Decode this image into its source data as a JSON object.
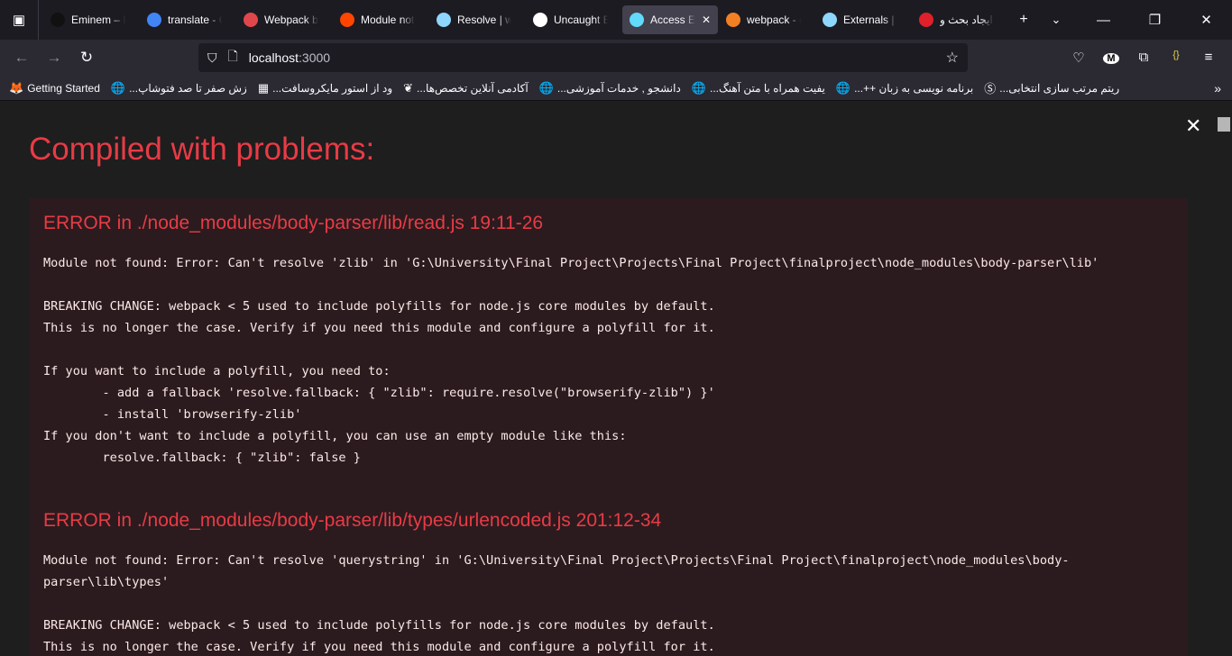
{
  "tabs": [
    {
      "label": "Eminem – B",
      "icon": "eminem-icon",
      "color": "#111111"
    },
    {
      "label": "translate - G",
      "icon": "google-icon",
      "color": "#4285f4"
    },
    {
      "label": "Webpack bu",
      "icon": "webpack-cube-icon",
      "color": "#e0474c"
    },
    {
      "label": "Module not",
      "icon": "reddit-icon",
      "color": "#ff4500"
    },
    {
      "label": "Resolve | we",
      "icon": "webpack-icon",
      "color": "#8ed6fb"
    },
    {
      "label": "Uncaught Er",
      "icon": "github-icon",
      "color": "#ffffff"
    },
    {
      "label": "Access E-",
      "icon": "react-icon",
      "color": "#61dafb",
      "active": true
    },
    {
      "label": "webpack - (",
      "icon": "stackoverflow-icon",
      "color": "#f48024"
    },
    {
      "label": "Externals | w",
      "icon": "webpack-icon",
      "color": "#8ed6fb"
    },
    {
      "label": "ایجاد بحث و",
      "icon": "magnet-icon",
      "color": "#e0202a"
    }
  ],
  "url": {
    "host": "localhost",
    "port": ":3000"
  },
  "bookmarks": [
    {
      "label": "Getting Started",
      "icon": "firefox-icon"
    },
    {
      "label": "...زش صفر تا صد فتوشاپ",
      "icon": "globe-icon"
    },
    {
      "label": "...ود از استور مایکروسافت",
      "icon": "microsoft-store-icon"
    },
    {
      "label": "...آکادمی آنلاین تخصص‌ها",
      "icon": "academy-icon"
    },
    {
      "label": "...دانشجو , خدمات آموزشی",
      "icon": "globe-icon"
    },
    {
      "label": "...یفیت همراه با متن آهنگ",
      "icon": "globe-icon"
    },
    {
      "label": "...++ برنامه نویسی به زبان",
      "icon": "globe-icon"
    },
    {
      "label": "...ریتم مرتب سازی انتخابی",
      "icon": "s-icon"
    }
  ],
  "overlay": {
    "title": "Compiled with problems:",
    "errors": [
      {
        "header": "ERROR in ./node_modules/body-parser/lib/read.js 19:11-26",
        "body": "Module not found: Error: Can't resolve 'zlib' in 'G:\\University\\Final Project\\Projects\\Final Project\\finalproject\\node_modules\\body-parser\\lib'\n\nBREAKING CHANGE: webpack < 5 used to include polyfills for node.js core modules by default.\nThis is no longer the case. Verify if you need this module and configure a polyfill for it.\n\nIf you want to include a polyfill, you need to:\n\t- add a fallback 'resolve.fallback: { \"zlib\": require.resolve(\"browserify-zlib\") }'\n\t- install 'browserify-zlib'\nIf you don't want to include a polyfill, you can use an empty module like this:\n\tresolve.fallback: { \"zlib\": false }"
      },
      {
        "header": "ERROR in ./node_modules/body-parser/lib/types/urlencoded.js 201:12-34",
        "body": "Module not found: Error: Can't resolve 'querystring' in 'G:\\University\\Final Project\\Projects\\Final Project\\finalproject\\node_modules\\body-parser\\lib\\types'\n\nBREAKING CHANGE: webpack < 5 used to include polyfills for node.js core modules by default.\nThis is no longer the case. Verify if you need this module and configure a polyfill for it."
      }
    ]
  }
}
